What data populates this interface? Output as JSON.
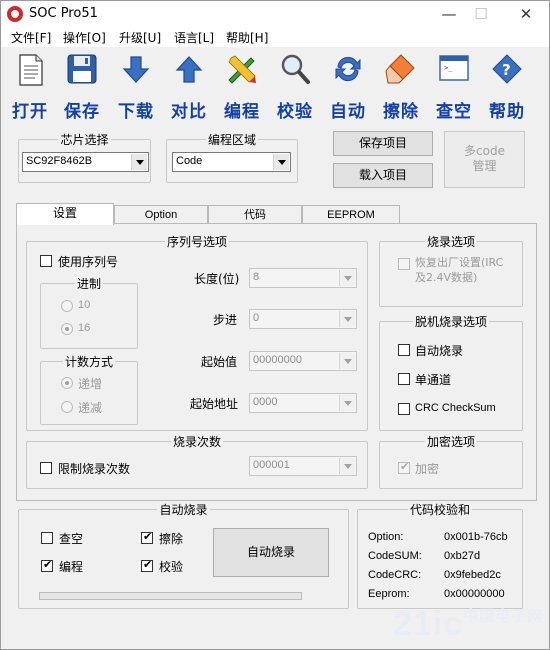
{
  "window": {
    "title": "SOC Pro51",
    "minimize": "—",
    "maximize": "☐",
    "close": "✕"
  },
  "menu": [
    "文件[F]",
    "操作[O]",
    "升级[U]",
    "语言[L]",
    "帮助[H]"
  ],
  "toolbar": [
    {
      "label": "打开",
      "icon": "document-icon"
    },
    {
      "label": "保存",
      "icon": "floppy-disk-icon"
    },
    {
      "label": "下载",
      "icon": "down-arrow-icon"
    },
    {
      "label": "对比",
      "icon": "up-arrow-icon"
    },
    {
      "label": "编程",
      "icon": "pencil-ruler-icon"
    },
    {
      "label": "校验",
      "icon": "magnifier-icon"
    },
    {
      "label": "自动",
      "icon": "refresh-icon"
    },
    {
      "label": "擦除",
      "icon": "eraser-icon"
    },
    {
      "label": "查空",
      "icon": "console-window-icon"
    },
    {
      "label": "帮助",
      "icon": "help-icon"
    }
  ],
  "chip": {
    "title": "芯片选择",
    "value": "SC92F8462B"
  },
  "area": {
    "title": "编程区域",
    "value": "Code"
  },
  "buttons": {
    "save_project": "保存项目",
    "load_project": "载入项目",
    "multicode_1": "多code",
    "multicode_2": "管理",
    "auto_burn": "自动烧录"
  },
  "tabs": [
    "设置",
    "Option",
    "代码",
    "EEPROM"
  ],
  "serial": {
    "title": "序列号选项",
    "use_serial": "使用序列号",
    "radix_title": "进制",
    "radix_options": [
      "10",
      "16"
    ],
    "count_title": "计数方式",
    "count_options": [
      "递增",
      "递减"
    ],
    "length_label": "长度(位)",
    "length_value": "8",
    "step_label": "步进",
    "step_value": "0",
    "start_label": "起始值",
    "start_value": "00000000",
    "addr_label": "起始地址",
    "addr_value": "0000"
  },
  "burn_options": {
    "title": "烧录选项",
    "restore_1": "恢复出厂设置(IRC",
    "restore_2": "及2.4V数据)"
  },
  "offline": {
    "title": "脱机烧录选项",
    "auto": "自动烧录",
    "single": "单通道",
    "crc": "CRC CheckSum"
  },
  "burn_count": {
    "title": "烧录次数",
    "limit": "限制烧录次数",
    "value": "000001"
  },
  "encrypt": {
    "title": "加密选项",
    "label": "加密"
  },
  "auto_burn": {
    "title": "自动烧录",
    "blank": "查空",
    "erase": "擦除",
    "program": "编程",
    "verify": "校验"
  },
  "checksum": {
    "title": "代码校验和",
    "rows": [
      {
        "label": "Option:",
        "value": "0x001b-76cb"
      },
      {
        "label": "CodeSUM:",
        "value": "0xb27d"
      },
      {
        "label": "CodeCRC:",
        "value": "0x9febed2c"
      },
      {
        "label": "Eeprom:",
        "value": "0x00000000"
      }
    ]
  },
  "watermark": {
    "main": "21ic",
    "sub": "中国电子网"
  }
}
